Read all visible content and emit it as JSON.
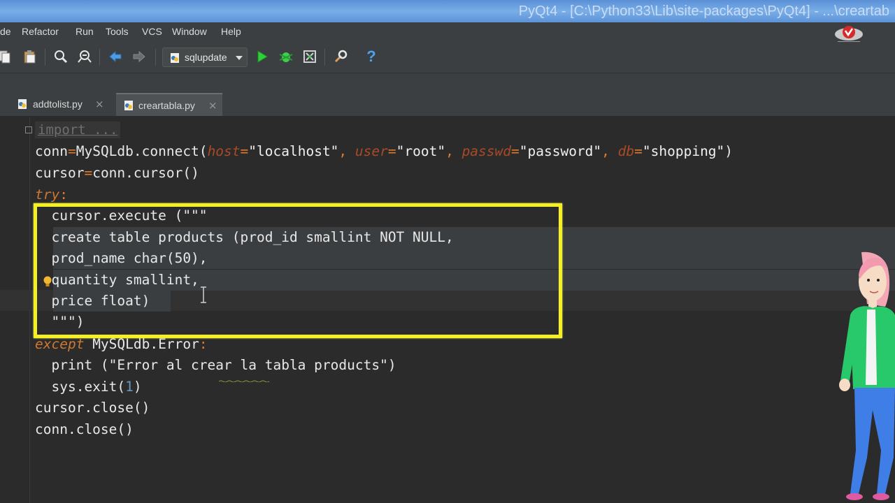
{
  "window": {
    "title": "PyQt4 - [C:\\Python33\\Lib\\site-packages\\PyQt4] - ...\\creartab"
  },
  "menu": {
    "items": [
      {
        "label": "de"
      },
      {
        "label": "Refactor"
      },
      {
        "label": "Run"
      },
      {
        "label": "Tools"
      },
      {
        "label": "VCS"
      },
      {
        "label": "Window"
      },
      {
        "label": "Help"
      }
    ]
  },
  "toolbar": {
    "run_config": "sqlupdate",
    "icons": [
      "copy-icon",
      "paste-icon",
      "find-icon",
      "replace-icon",
      "back-arrow-icon",
      "forward-arrow-icon",
      "run-icon",
      "debug-icon",
      "coverage-icon",
      "settings-icon",
      "help-icon"
    ]
  },
  "tabs": [
    {
      "label": "addtolist.py",
      "active": false
    },
    {
      "label": "creartabla.py",
      "active": true
    }
  ],
  "editor": {
    "folded_import": "import ...",
    "lines": {
      "l1": {
        "a": "conn",
        "b": "=",
        "c": "MySQLdb.connect(",
        "d": "host",
        "e": "=",
        "f": "\"localhost\"",
        "g": ", ",
        "h": "user",
        "i": "=",
        "j": "\"root\"",
        "k": ", ",
        "l": "passwd",
        "m": "=",
        "n": "\"password\"",
        "o": ", ",
        "p": "db",
        "q": "=",
        "r": "\"shopping\"",
        "s": ")"
      },
      "l2": {
        "a": "cursor",
        "b": "=",
        "c": "conn.cursor()"
      },
      "l3": {
        "a": "try",
        "b": ":"
      },
      "l4": "  cursor.execute (\"\"\"",
      "l5": "  create table products (prod_id smallint NOT NULL,",
      "l6": "  prod_name char(50),",
      "l7": "  quantity smallint,",
      "l8": "  price float)",
      "l9": "  \"\"\")",
      "l10": {
        "a": "except",
        "b": " MySQLdb.Error",
        "c": ":"
      },
      "l11": "  print (\"Error al crear la tabla products\")",
      "l12": {
        "a": "  sys.exit(",
        "b": "1",
        "c": ")"
      },
      "l13": "cursor.close()",
      "l14": "conn.close()"
    }
  },
  "colors": {
    "highlight_box": "#f5f024",
    "keyword": "#cc7832",
    "param": "#aa4926"
  }
}
